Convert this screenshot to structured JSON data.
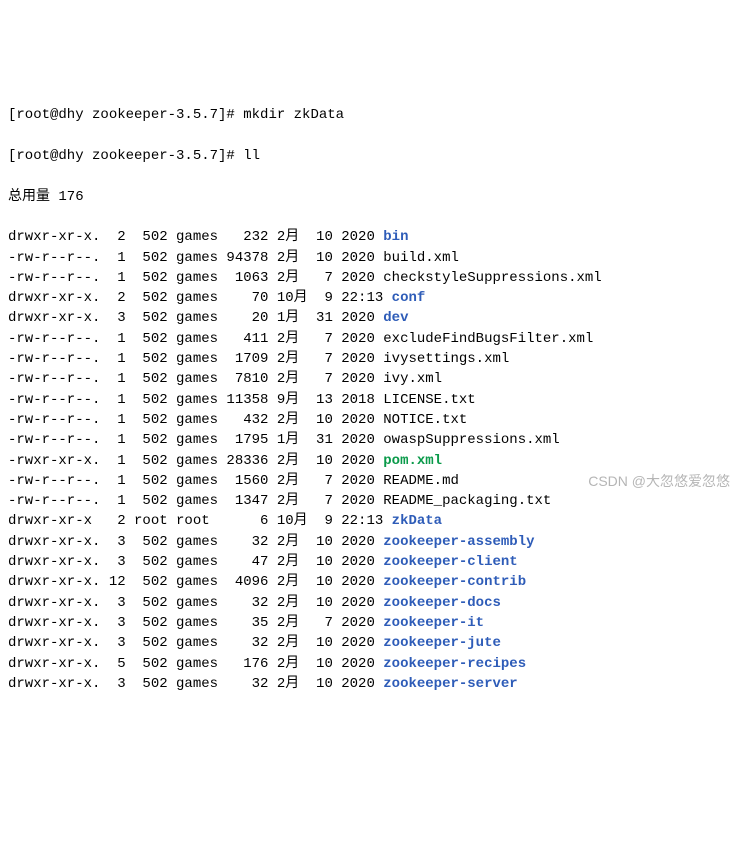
{
  "prompt1": {
    "user_host": "[root@dhy zookeeper-3.5.7]#",
    "cmd": "mkdir zkData"
  },
  "prompt2": {
    "user_host": "[root@dhy zookeeper-3.5.7]#",
    "cmd": "ll"
  },
  "total": "总用量 176",
  "rows": [
    {
      "perm": "drwxr-xr-x.",
      "links": " 2",
      "owner": " 502",
      "group": "games",
      "size": "  232",
      "month": "2月 ",
      "day": "10",
      "time": "2020",
      "name": "bin",
      "cls": "dir"
    },
    {
      "perm": "-rw-r--r--.",
      "links": " 1",
      "owner": " 502",
      "group": "games",
      "size": "94378",
      "month": "2月 ",
      "day": "10",
      "time": "2020",
      "name": "build.xml",
      "cls": ""
    },
    {
      "perm": "-rw-r--r--.",
      "links": " 1",
      "owner": " 502",
      "group": "games",
      "size": " 1063",
      "month": "2月 ",
      "day": " 7",
      "time": "2020",
      "name": "checkstyleSuppressions.xml",
      "cls": ""
    },
    {
      "perm": "drwxr-xr-x.",
      "links": " 2",
      "owner": " 502",
      "group": "games",
      "size": "   70",
      "month": "10月",
      "day": " 9",
      "time": "22:13",
      "name": "conf",
      "cls": "dir"
    },
    {
      "perm": "drwxr-xr-x.",
      "links": " 3",
      "owner": " 502",
      "group": "games",
      "size": "   20",
      "month": "1月 ",
      "day": "31",
      "time": "2020",
      "name": "dev",
      "cls": "dir"
    },
    {
      "perm": "-rw-r--r--.",
      "links": " 1",
      "owner": " 502",
      "group": "games",
      "size": "  411",
      "month": "2月 ",
      "day": " 7",
      "time": "2020",
      "name": "excludeFindBugsFilter.xml",
      "cls": ""
    },
    {
      "perm": "-rw-r--r--.",
      "links": " 1",
      "owner": " 502",
      "group": "games",
      "size": " 1709",
      "month": "2月 ",
      "day": " 7",
      "time": "2020",
      "name": "ivysettings.xml",
      "cls": ""
    },
    {
      "perm": "-rw-r--r--.",
      "links": " 1",
      "owner": " 502",
      "group": "games",
      "size": " 7810",
      "month": "2月 ",
      "day": " 7",
      "time": "2020",
      "name": "ivy.xml",
      "cls": ""
    },
    {
      "perm": "-rw-r--r--.",
      "links": " 1",
      "owner": " 502",
      "group": "games",
      "size": "11358",
      "month": "9月 ",
      "day": "13",
      "time": "2018",
      "name": "LICENSE.txt",
      "cls": ""
    },
    {
      "perm": "-rw-r--r--.",
      "links": " 1",
      "owner": " 502",
      "group": "games",
      "size": "  432",
      "month": "2月 ",
      "day": "10",
      "time": "2020",
      "name": "NOTICE.txt",
      "cls": ""
    },
    {
      "perm": "-rw-r--r--.",
      "links": " 1",
      "owner": " 502",
      "group": "games",
      "size": " 1795",
      "month": "1月 ",
      "day": "31",
      "time": "2020",
      "name": "owaspSuppressions.xml",
      "cls": ""
    },
    {
      "perm": "-rwxr-xr-x.",
      "links": " 1",
      "owner": " 502",
      "group": "games",
      "size": "28336",
      "month": "2月 ",
      "day": "10",
      "time": "2020",
      "name": "pom.xml",
      "cls": "exec"
    },
    {
      "perm": "-rw-r--r--.",
      "links": " 1",
      "owner": " 502",
      "group": "games",
      "size": " 1560",
      "month": "2月 ",
      "day": " 7",
      "time": "2020",
      "name": "README.md",
      "cls": ""
    },
    {
      "perm": "-rw-r--r--.",
      "links": " 1",
      "owner": " 502",
      "group": "games",
      "size": " 1347",
      "month": "2月 ",
      "day": " 7",
      "time": "2020",
      "name": "README_packaging.txt",
      "cls": ""
    },
    {
      "perm": "drwxr-xr-x ",
      "links": " 2",
      "owner": "root",
      "group": "root ",
      "size": "    6",
      "month": "10月",
      "day": " 9",
      "time": "22:13",
      "name": "zkData",
      "cls": "dir"
    },
    {
      "perm": "drwxr-xr-x.",
      "links": " 3",
      "owner": " 502",
      "group": "games",
      "size": "   32",
      "month": "2月 ",
      "day": "10",
      "time": "2020",
      "name": "zookeeper-assembly",
      "cls": "dir"
    },
    {
      "perm": "drwxr-xr-x.",
      "links": " 3",
      "owner": " 502",
      "group": "games",
      "size": "   47",
      "month": "2月 ",
      "day": "10",
      "time": "2020",
      "name": "zookeeper-client",
      "cls": "dir"
    },
    {
      "perm": "drwxr-xr-x.",
      "links": "12",
      "owner": " 502",
      "group": "games",
      "size": " 4096",
      "month": "2月 ",
      "day": "10",
      "time": "2020",
      "name": "zookeeper-contrib",
      "cls": "dir"
    },
    {
      "perm": "drwxr-xr-x.",
      "links": " 3",
      "owner": " 502",
      "group": "games",
      "size": "   32",
      "month": "2月 ",
      "day": "10",
      "time": "2020",
      "name": "zookeeper-docs",
      "cls": "dir"
    },
    {
      "perm": "drwxr-xr-x.",
      "links": " 3",
      "owner": " 502",
      "group": "games",
      "size": "   35",
      "month": "2月 ",
      "day": " 7",
      "time": "2020",
      "name": "zookeeper-it",
      "cls": "dir"
    },
    {
      "perm": "drwxr-xr-x.",
      "links": " 3",
      "owner": " 502",
      "group": "games",
      "size": "   32",
      "month": "2月 ",
      "day": "10",
      "time": "2020",
      "name": "zookeeper-jute",
      "cls": "dir"
    },
    {
      "perm": "drwxr-xr-x.",
      "links": " 5",
      "owner": " 502",
      "group": "games",
      "size": "  176",
      "month": "2月 ",
      "day": "10",
      "time": "2020",
      "name": "zookeeper-recipes",
      "cls": "dir"
    },
    {
      "perm": "drwxr-xr-x.",
      "links": " 3",
      "owner": " 502",
      "group": "games",
      "size": "   32",
      "month": "2月 ",
      "day": "10",
      "time": "2020",
      "name": "zookeeper-server",
      "cls": "dir"
    }
  ],
  "watermark": "CSDN @大忽悠爱忽悠"
}
